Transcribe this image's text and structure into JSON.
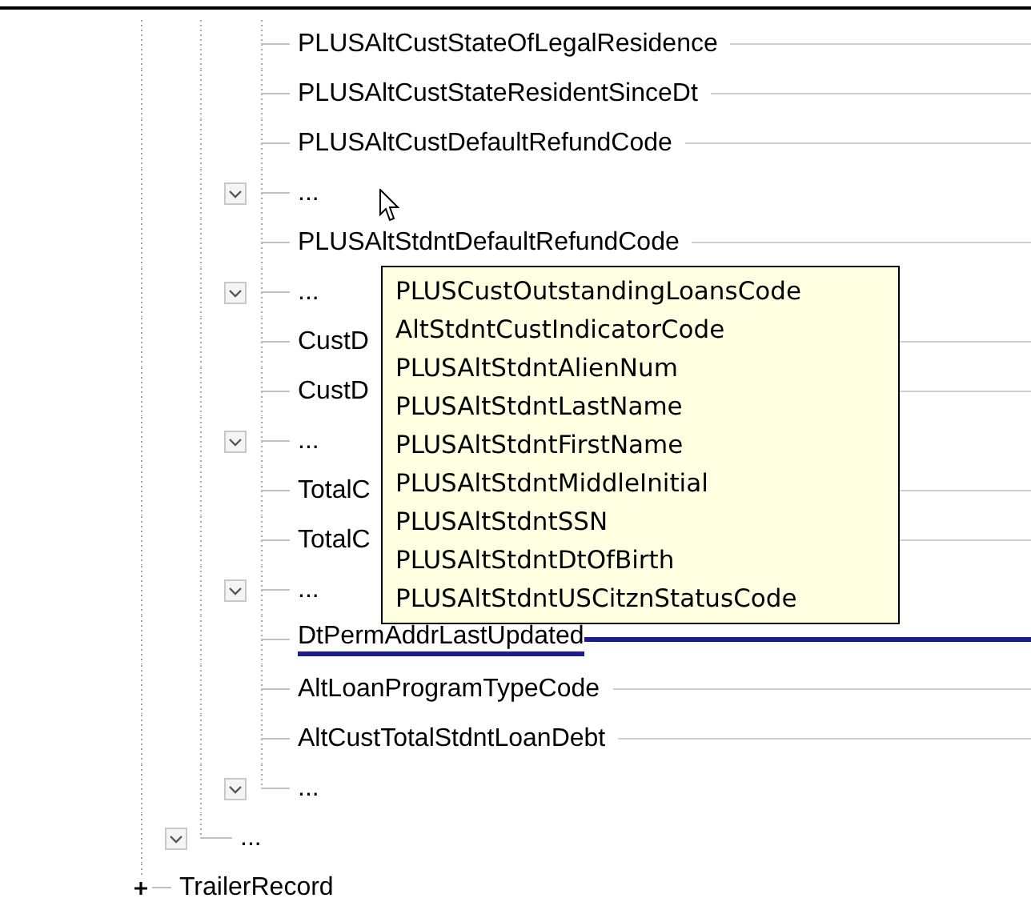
{
  "tree": {
    "children": [
      {
        "children": [
          {
            "children": [
              {
                "label": "PLUSAltCustStateOfLegalResidence",
                "highlighted": false
              },
              {
                "label": "PLUSAltCustStateResidentSinceDt",
                "highlighted": false
              },
              {
                "label": "PLUSAltCustDefaultRefundCode",
                "highlighted": false
              },
              {
                "label": "...",
                "expanded": true,
                "highlighted": false
              },
              {
                "label": "PLUSAltStdntDefaultRefundCode",
                "highlighted": false
              },
              {
                "label": "...",
                "expanded": true,
                "highlighted": false
              },
              {
                "label": "CustD",
                "highlighted": false
              },
              {
                "label": "CustD",
                "highlighted": false
              },
              {
                "label": "...",
                "expanded": true,
                "highlighted": false
              },
              {
                "label": "TotalC",
                "highlighted": false
              },
              {
                "label": "TotalC",
                "highlighted": false
              },
              {
                "label": "...",
                "expanded": true,
                "highlighted": false
              },
              {
                "label": "DtPermAddrLastUpdated",
                "highlighted": true
              },
              {
                "label": "AltLoanProgramTypeCode",
                "highlighted": false
              },
              {
                "label": "AltCustTotalStdntLoanDebt",
                "highlighted": false
              },
              {
                "label": "...",
                "expanded": true,
                "highlighted": false
              }
            ]
          },
          {
            "label": "...",
            "expanded": true
          }
        ]
      },
      {
        "label": "TrailerRecord",
        "expanded": false
      }
    ]
  },
  "tooltip": {
    "lines": [
      "PLUSCustOutstandingLoansCode",
      "AltStdntCustIndicatorCode",
      "PLUSAltStdntAlienNum",
      "PLUSAltStdntLastName",
      "PLUSAltStdntFirstName",
      "PLUSAltStdntMiddleInitial",
      "PLUSAltStdntSSN",
      "PLUSAltStdntDtOfBirth",
      "PLUSAltStdntUSCitznStatusCode"
    ]
  }
}
